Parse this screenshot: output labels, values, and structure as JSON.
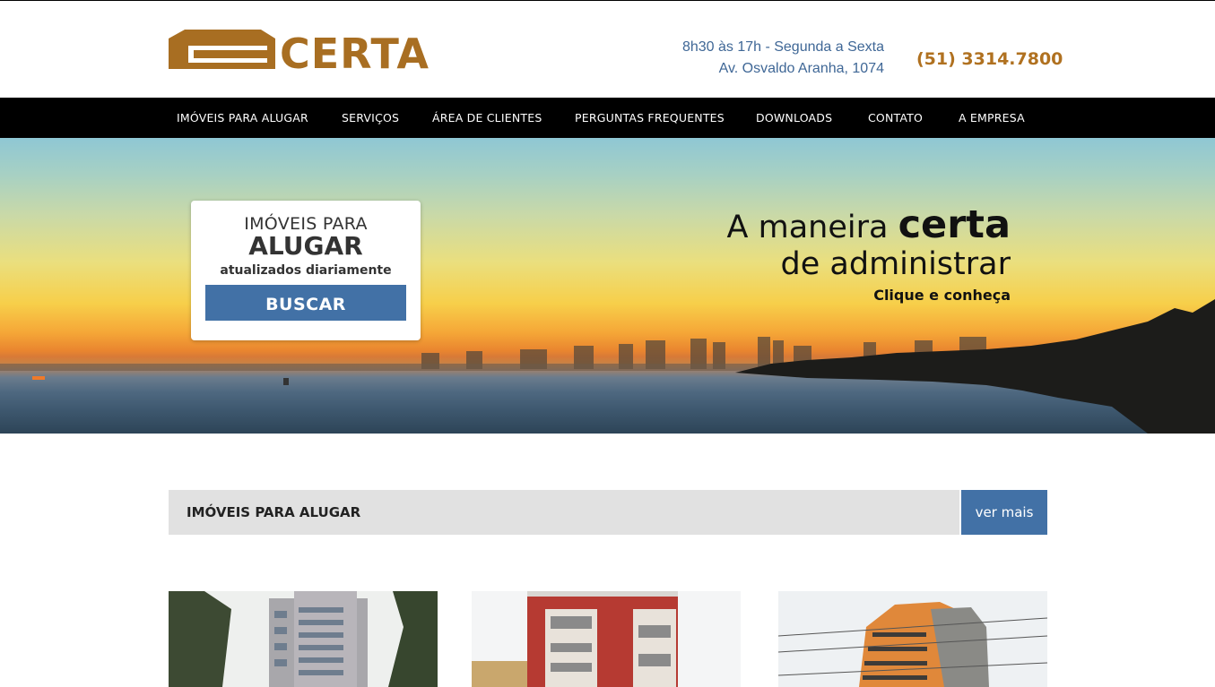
{
  "brand": {
    "name": "CERTA",
    "logo_color": "#a86e22"
  },
  "header": {
    "hours": "8h30 às 17h - Segunda a Sexta",
    "address": "Av. Osvaldo Aranha, 1074",
    "phone": "(51) 3314.7800",
    "phone_color": "#b07120",
    "info_color": "#3f6796"
  },
  "nav": {
    "items": [
      {
        "label": "IMÓVEIS PARA ALUGAR"
      },
      {
        "label": "SERVIÇOS"
      },
      {
        "label": "ÁREA DE CLIENTES"
      },
      {
        "label": "PERGUNTAS FREQUENTES"
      },
      {
        "label": "DOWNLOADS"
      },
      {
        "label": "CONTATO"
      },
      {
        "label": "A EMPRESA"
      }
    ]
  },
  "search_box": {
    "line1": "IMÓVEIS PARA",
    "line2": "ALUGAR",
    "line3": "atualizados diariamente",
    "button": "BUSCAR"
  },
  "slogan": {
    "prefix": "A maneira ",
    "emphasis": "certa",
    "line2": "de administrar",
    "cta": "Clique e conheça"
  },
  "listing": {
    "title": "IMÓVEIS PARA ALUGAR",
    "more": "ver mais",
    "accent": "#4271a6"
  },
  "properties": [
    {
      "icon": "building-photo"
    },
    {
      "icon": "building-photo"
    },
    {
      "icon": "building-photo"
    }
  ]
}
